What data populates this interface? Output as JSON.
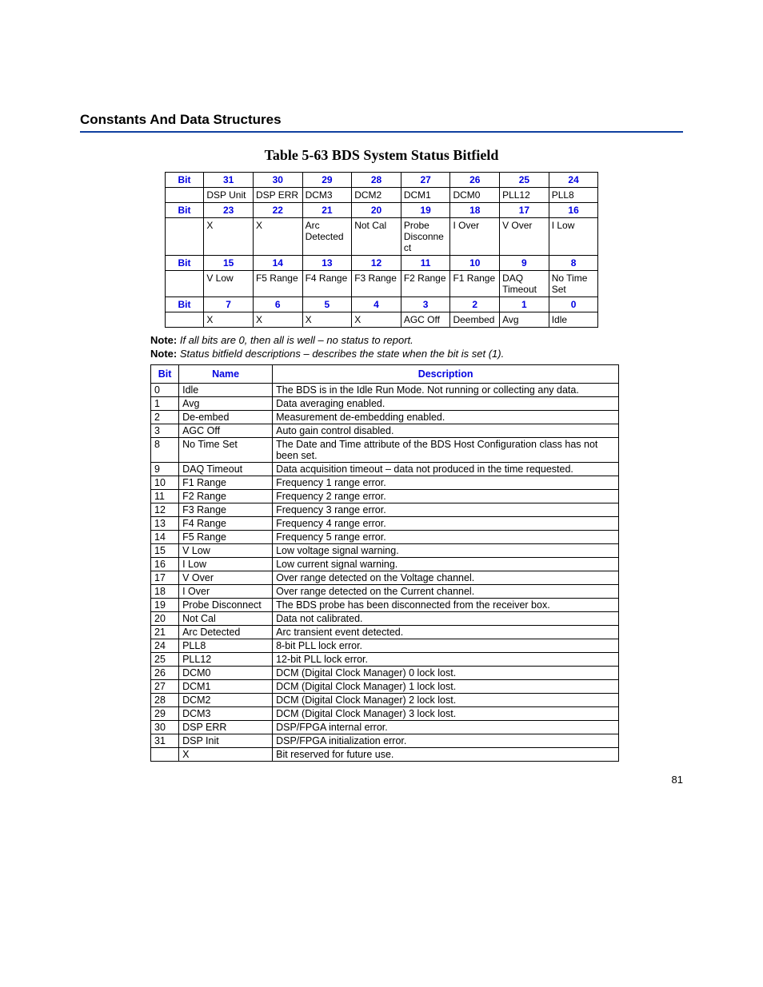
{
  "headings": {
    "section": "Constants And Data Structures",
    "tableTitle": "Table 5-63   BDS System Status Bitfield"
  },
  "bitfield": {
    "bitLabel": "Bit",
    "rows": [
      {
        "bits": [
          "31",
          "30",
          "29",
          "28",
          "27",
          "26",
          "25",
          "24"
        ],
        "names": [
          "DSP Unit",
          "DSP ERR",
          "DCM3",
          "DCM2",
          "DCM1",
          "DCM0",
          "PLL12",
          "PLL8"
        ]
      },
      {
        "bits": [
          "23",
          "22",
          "21",
          "20",
          "19",
          "18",
          "17",
          "16"
        ],
        "names": [
          "X",
          "X",
          "Arc Detected",
          "Not Cal",
          "Probe Disconnect",
          "I Over",
          "V Over",
          "I Low"
        ]
      },
      {
        "bits": [
          "15",
          "14",
          "13",
          "12",
          "11",
          "10",
          "9",
          "8"
        ],
        "names": [
          "V Low",
          "F5 Range",
          "F4 Range",
          "F3 Range",
          "F2 Range",
          "F1 Range",
          "DAQ Timeout",
          "No Time Set"
        ]
      },
      {
        "bits": [
          "7",
          "6",
          "5",
          "4",
          "3",
          "2",
          "1",
          "0"
        ],
        "names": [
          "X",
          "X",
          "X",
          "X",
          "AGC Off",
          "Deembed",
          "Avg",
          "Idle"
        ]
      }
    ]
  },
  "notes": {
    "label": "Note:",
    "n1": "If all bits are 0, then all is well – no status to report.",
    "n2": "Status bitfield descriptions – describes the state when the bit is set (1)."
  },
  "descTable": {
    "headers": {
      "bit": "Bit",
      "name": "Name",
      "desc": "Description"
    },
    "rows": [
      {
        "bit": "0",
        "name": "Idle",
        "desc": "The BDS is in the Idle Run Mode. Not running or collecting any data."
      },
      {
        "bit": "1",
        "name": "Avg",
        "desc": "Data averaging enabled."
      },
      {
        "bit": "2",
        "name": "De-embed",
        "desc": "Measurement de-embedding enabled."
      },
      {
        "bit": "3",
        "name": "AGC Off",
        "desc": "Auto gain control disabled."
      },
      {
        "bit": "8",
        "name": "No Time Set",
        "desc": "The Date and Time attribute of the BDS Host Configuration class has not been set."
      },
      {
        "bit": "9",
        "name": "DAQ Timeout",
        "desc": "Data acquisition timeout – data not produced in the time requested."
      },
      {
        "bit": "10",
        "name": "F1 Range",
        "desc": "Frequency 1 range error."
      },
      {
        "bit": "11",
        "name": "F2 Range",
        "desc": "Frequency 2 range error."
      },
      {
        "bit": "12",
        "name": "F3 Range",
        "desc": "Frequency 3 range error."
      },
      {
        "bit": "13",
        "name": "F4 Range",
        "desc": "Frequency 4 range error."
      },
      {
        "bit": "14",
        "name": "F5 Range",
        "desc": "Frequency 5 range error."
      },
      {
        "bit": "15",
        "name": "V Low",
        "desc": "Low voltage signal warning."
      },
      {
        "bit": "16",
        "name": "I Low",
        "desc": "Low current signal warning."
      },
      {
        "bit": "17",
        "name": "V Over",
        "desc": "Over range detected on the Voltage channel."
      },
      {
        "bit": "18",
        "name": "I Over",
        "desc": "Over range detected on the Current channel."
      },
      {
        "bit": "19",
        "name": "Probe Disconnect",
        "desc": "The BDS probe has been disconnected from the receiver box."
      },
      {
        "bit": "20",
        "name": "Not Cal",
        "desc": "Data not calibrated."
      },
      {
        "bit": "21",
        "name": "Arc Detected",
        "desc": "Arc transient event detected."
      },
      {
        "bit": "24",
        "name": "PLL8",
        "desc": "8-bit PLL lock error."
      },
      {
        "bit": "25",
        "name": "PLL12",
        "desc": "12-bit PLL lock error."
      },
      {
        "bit": "26",
        "name": "DCM0",
        "desc": "DCM (Digital Clock Manager) 0 lock lost."
      },
      {
        "bit": "27",
        "name": "DCM1",
        "desc": "DCM (Digital Clock Manager) 1 lock lost."
      },
      {
        "bit": "28",
        "name": "DCM2",
        "desc": "DCM (Digital Clock Manager) 2 lock lost."
      },
      {
        "bit": "29",
        "name": "DCM3",
        "desc": "DCM (Digital Clock Manager) 3 lock lost."
      },
      {
        "bit": "30",
        "name": "DSP ERR",
        "desc": "DSP/FPGA internal error."
      },
      {
        "bit": "31",
        "name": "DSP Init",
        "desc": "DSP/FPGA initialization error."
      },
      {
        "bit": "",
        "name": "X",
        "desc": "Bit reserved for future use."
      }
    ]
  },
  "pageNumber": "81"
}
